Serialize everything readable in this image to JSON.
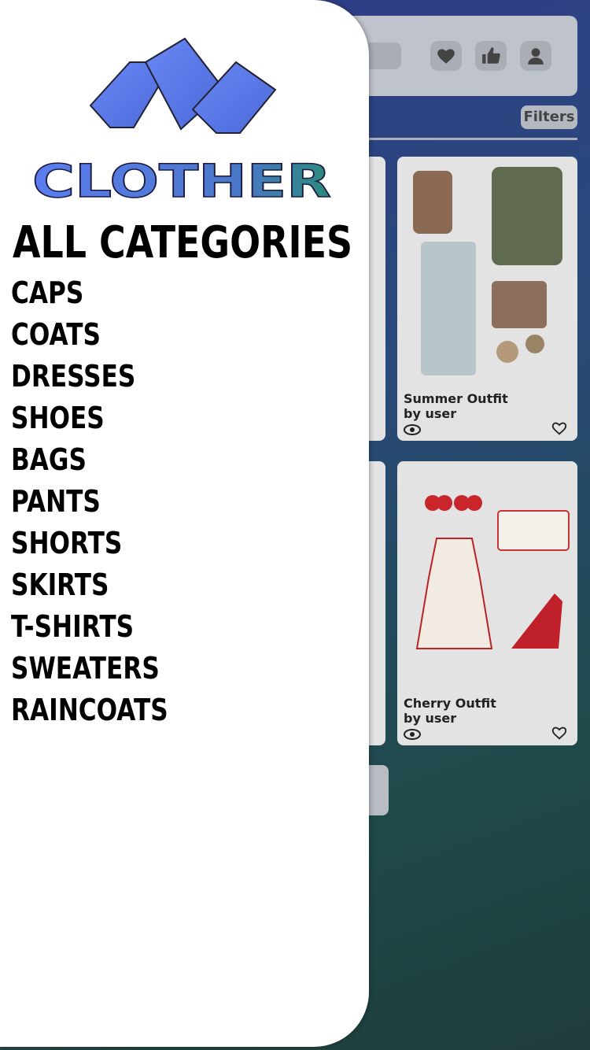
{
  "app": {
    "name": "CLOTHER"
  },
  "header": {
    "filters_label": "Filters",
    "icons": [
      "heart-icon",
      "thumbs-up-icon",
      "user-icon"
    ]
  },
  "drawer": {
    "heading": "ALL CATEGORIES",
    "categories": [
      "CAPS",
      "COATS",
      "DRESSES",
      "SHOES",
      "BAGS",
      "PANTS",
      "SHORTS",
      "SKIRTS",
      "T-SHIRTS",
      "SWEATERS",
      "RAINCOATS"
    ]
  },
  "outfits": [
    {
      "title": "Summer Outfit",
      "author": "by user"
    },
    {
      "title": "Cherry Outfit",
      "author": "by user"
    }
  ],
  "colors": {
    "brand_blue": "#5b7cf0",
    "brand_teal": "#2a8a7a",
    "background": "#2f3a8a",
    "drawer": "#ffffff"
  }
}
